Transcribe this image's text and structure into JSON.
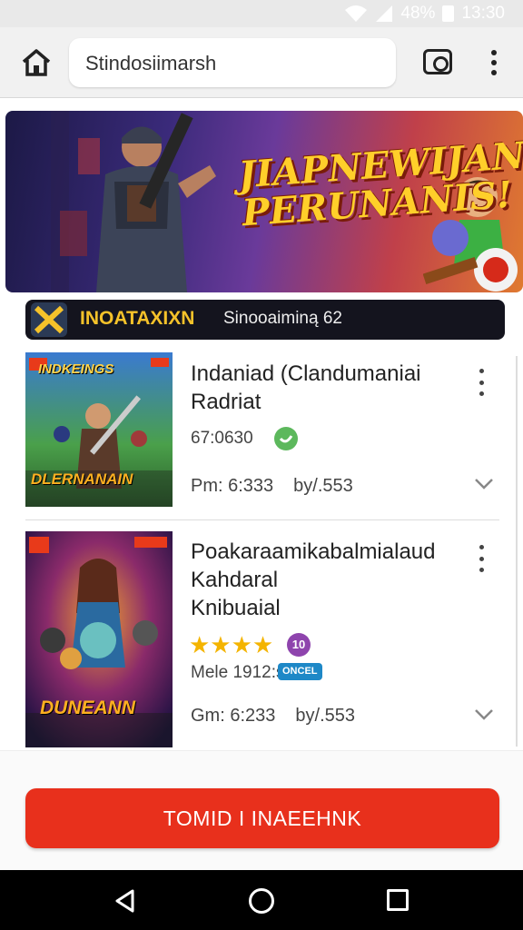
{
  "status_bar": {
    "battery": "48%",
    "time": "13:30",
    "icons": [
      "wifi-icon",
      "signal-icon",
      "battery-icon"
    ]
  },
  "browser": {
    "url": "Stindosiimarsh",
    "icons": [
      "home-icon",
      "tab-switcher-icon",
      "more-vert-icon"
    ]
  },
  "hero": {
    "title_line1": "JIAPNEWIJAN",
    "title_line2": "PERUNANIS!"
  },
  "category": {
    "bold_label": "INOATAXIXN",
    "light_label": "Sinooaiminą 62"
  },
  "items": [
    {
      "title_line1": "Indaniad (Clandumaniai",
      "title_line2": "Radriat",
      "meta": "67:0630",
      "price": "Pm: 6:333",
      "byline": "by/.553",
      "thumb_label_top": "INDKEINGS",
      "thumb_label_bottom": "DLERNANAIN"
    },
    {
      "title_line1": "Poakaraamikabalmialaud",
      "title_line2": "Kahdaral",
      "title_line3": "Knibuaial",
      "rating": 4,
      "rating_glyph": "★★★★",
      "purple_badge": "10",
      "meta": "Mele 1912:s",
      "blue_badge": "ONCEL",
      "price": "Gm: 6:233",
      "byline": "by/.553",
      "thumb_label_bottom": "DUNEANN"
    }
  ],
  "cta": {
    "label": "TOMID I INAEEHNK"
  },
  "colors": {
    "accent": "#e8301c",
    "strip": "#14141e",
    "star": "#f4b400"
  }
}
